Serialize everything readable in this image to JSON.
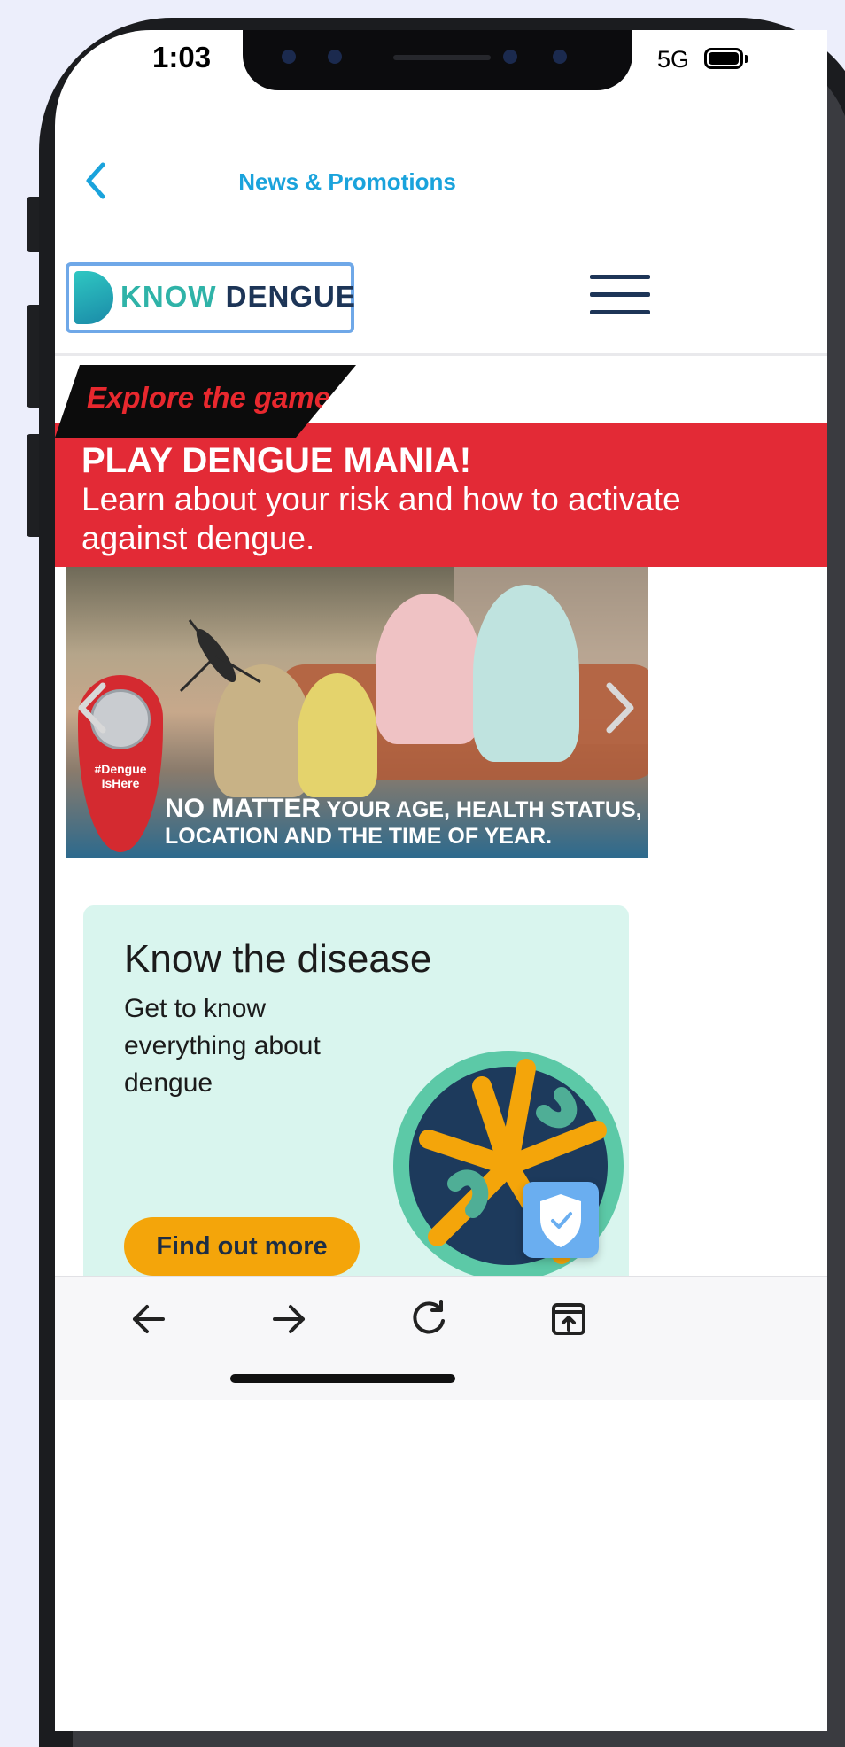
{
  "status_bar": {
    "time": "1:03",
    "network": "5G"
  },
  "app_header": {
    "title": "News & Promotions",
    "back_icon": "chevron-left-icon"
  },
  "site_header": {
    "logo_know": "KNOW",
    "logo_dengue": "DENGUE",
    "menu_icon": "hamburger-menu-icon"
  },
  "banner": {
    "tag": "Explore the game",
    "title": "PLAY DENGUE MANIA!",
    "subtitle": "Learn about your risk and how to activate against dengue."
  },
  "carousel": {
    "pin_tag": "#Dengue IsHere",
    "caption_big": "NO MATTER",
    "caption_rest": "YOUR AGE, HEALTH STATUS, LOCATION AND THE TIME OF YEAR.",
    "prev_icon": "chevron-left-icon",
    "next_icon": "chevron-right-icon"
  },
  "card": {
    "title": "Know the disease",
    "text": "Get to know everything about dengue",
    "button": "Find out more"
  },
  "toolbar": {
    "back_icon": "arrow-left-icon",
    "forward_icon": "arrow-right-icon",
    "reload_icon": "reload-icon",
    "share_icon": "open-in-browser-icon"
  },
  "colors": {
    "accent_blue": "#1aa3dc",
    "banner_red": "#e32a36",
    "card_bg": "#d9f5ee",
    "button_yellow": "#f4a50a",
    "logo_teal": "#2fb3a8",
    "logo_navy": "#1d3557"
  }
}
